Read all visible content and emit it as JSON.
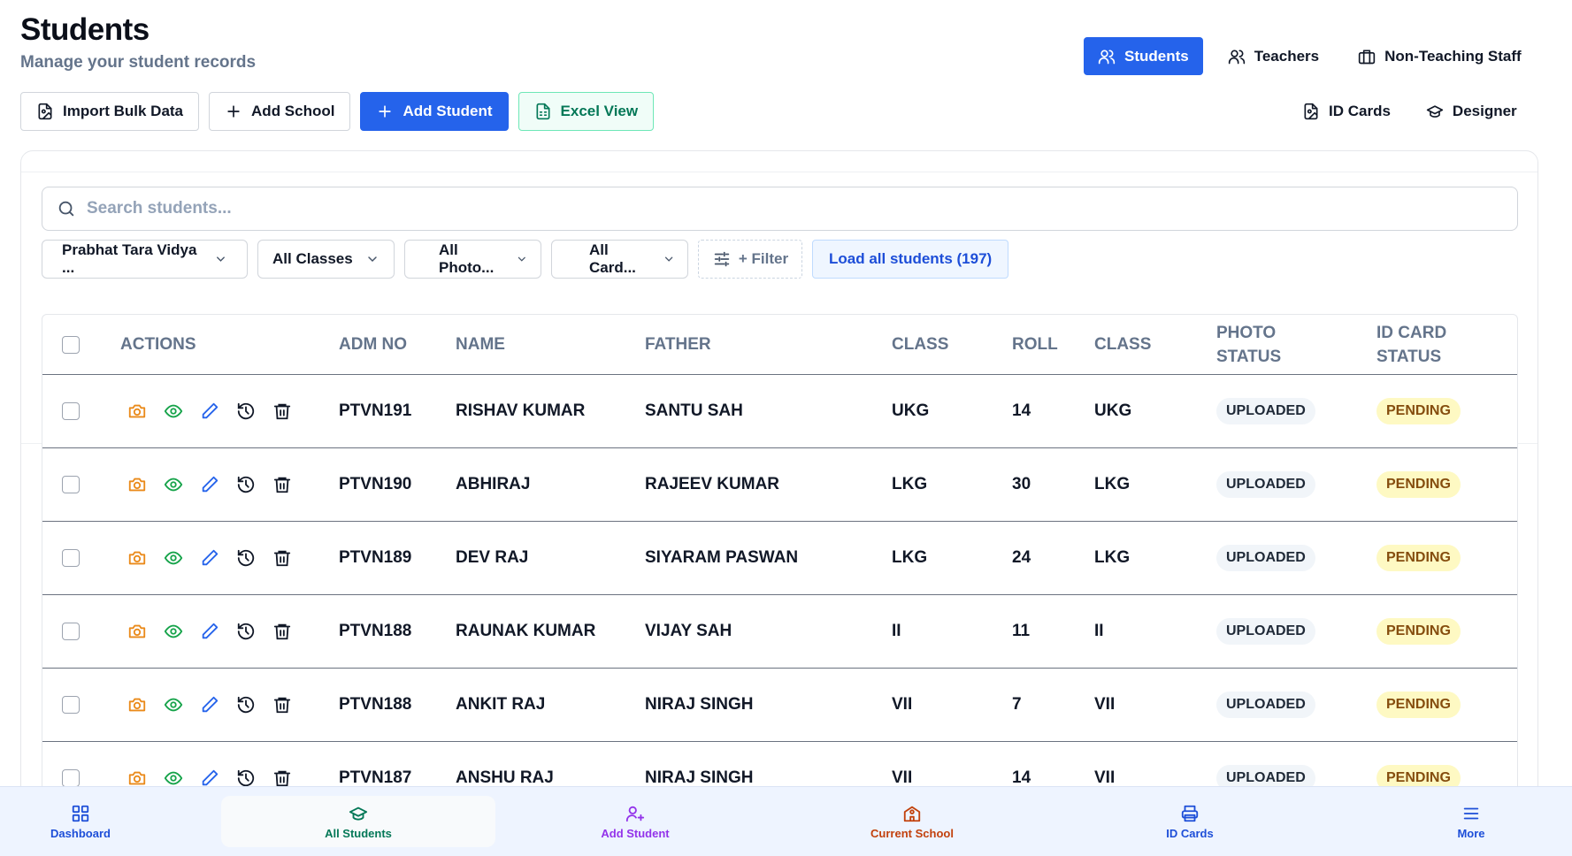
{
  "page": {
    "title": "Students",
    "subtitle": "Manage your student records"
  },
  "nav_tabs": [
    {
      "label": "Students",
      "icon": "users-icon",
      "active": true
    },
    {
      "label": "Teachers",
      "icon": "users-icon",
      "active": false
    },
    {
      "label": "Non-Teaching Staff",
      "icon": "briefcase-icon",
      "active": false
    }
  ],
  "toolbar": {
    "import_label": "Import Bulk Data",
    "add_school_label": "Add School",
    "add_student_label": "Add Student",
    "excel_label": "Excel View",
    "id_cards_label": "ID Cards",
    "designer_label": "Designer"
  },
  "filters": {
    "search_placeholder": "Search students...",
    "school": "Prabhat Tara Vidya ...",
    "classes": "All Classes",
    "photo": "All Photo...",
    "card": "All Card...",
    "filter_label": "+ Filter",
    "load_all_label": "Load all students (197)"
  },
  "table": {
    "headers": {
      "actions": "ACTIONS",
      "adm_no": "ADM NO",
      "name": "NAME",
      "father": "FATHER",
      "class": "CLASS",
      "roll": "ROLL",
      "class2": "CLASS",
      "photo_status_1": "PHOTO",
      "photo_status_2": "STATUS",
      "id_status_1": "ID CARD",
      "id_status_2": "STATUS"
    },
    "rows": [
      {
        "adm": "PTVN191",
        "name": "RISHAV KUMAR",
        "father": "SANTU SAH",
        "class": "UKG",
        "roll": "14",
        "class2": "UKG",
        "photo": "UPLOADED",
        "id": "PENDING"
      },
      {
        "adm": "PTVN190",
        "name": "ABHIRAJ",
        "father": "RAJEEV KUMAR",
        "class": "LKG",
        "roll": "30",
        "class2": "LKG",
        "photo": "UPLOADED",
        "id": "PENDING"
      },
      {
        "adm": "PTVN189",
        "name": "DEV RAJ",
        "father": "SIYARAM PASWAN",
        "class": "LKG",
        "roll": "24",
        "class2": "LKG",
        "photo": "UPLOADED",
        "id": "PENDING"
      },
      {
        "adm": "PTVN188",
        "name": "RAUNAK KUMAR",
        "father": "VIJAY SAH",
        "class": "II",
        "roll": "11",
        "class2": "II",
        "photo": "UPLOADED",
        "id": "PENDING"
      },
      {
        "adm": "PTVN188",
        "name": "ANKIT RAJ",
        "father": "NIRAJ SINGH",
        "class": "VII",
        "roll": "7",
        "class2": "VII",
        "photo": "UPLOADED",
        "id": "PENDING"
      },
      {
        "adm": "PTVN187",
        "name": "ANSHU RAJ",
        "father": "NIRAJ SINGH",
        "class": "VII",
        "roll": "14",
        "class2": "VII",
        "photo": "UPLOADED",
        "id": "PENDING"
      }
    ]
  },
  "bottom_nav": [
    {
      "label": "Dashboard",
      "icon": "dashboard-icon",
      "color": "#1d4ed8"
    },
    {
      "label": "All Students",
      "icon": "graduation-cap-icon",
      "color": "#047857"
    },
    {
      "label": "Add Student",
      "icon": "user-plus-icon",
      "color": "#9333ea"
    },
    {
      "label": "Current School",
      "icon": "school-icon",
      "color": "#c2410c"
    },
    {
      "label": "ID Cards",
      "icon": "printer-icon",
      "color": "#1d4ed8"
    },
    {
      "label": "More",
      "icon": "menu-icon",
      "color": "#1d4ed8"
    }
  ],
  "colors": {
    "primary": "#2563eb",
    "excel": "#047857",
    "pending_bg": "#fef9c3",
    "uploaded_bg": "#f1f5f9"
  }
}
